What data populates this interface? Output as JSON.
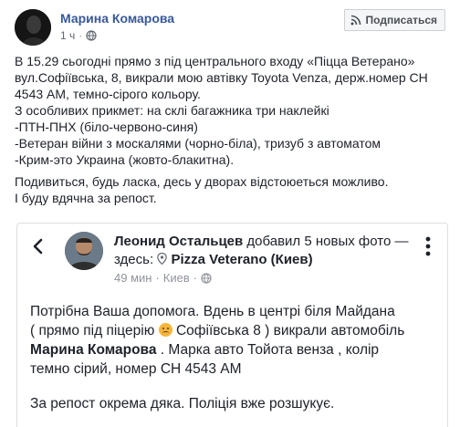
{
  "post": {
    "author": "Марина Комарова",
    "time": "1 ч",
    "privacy_icon": "globe-icon",
    "subscribe_label": "Подписаться",
    "subscribe_icon": "rss-icon",
    "lines": [
      "В 15.29 сьогодні прямо з під центрального входу «Піцца Ветерано»",
      "вул.Софіївська, 8, викрали мою автівку Toyota Venza, держ.номер СН",
      "4543 АМ, темно-сірого кольору.",
      "З особливих прикмет: на склі багажника три наклейкі",
      "-ПТН-ПНХ (біло-червоно-синя)",
      "-Ветеран війни з москалями (чорно-біла), тризуб з автоматом",
      "-Крим-это Украина (жовто-блакитна)."
    ],
    "lines2": [
      "Подивиться, будь ласка, десь у дворах відстоюеться можливо.",
      "І буду вдячна за репост."
    ]
  },
  "shared": {
    "author": "Леонид Остальцев",
    "action": " добавил 5 новых фото — здесь: ",
    "place": "Pizza Veterano (Киев)",
    "time": "49 мин",
    "location": "Киев",
    "body": {
      "line1": "Потрібна Ваша допомога. Вдень в центрі біля Майдана",
      "line2a": "( прямо під піцерію ",
      "line2b": " Софіївська 8 ) викрали автомобіль",
      "line3_name": "Марина Комарова",
      "line3_rest": " . Марка авто Тойота венза , колір",
      "line4": "темно сірий, номер СН 4543 АМ",
      "line5": "За репост окрема дяка. Поліція вже розшукує."
    }
  },
  "colors": {
    "link": "#385898",
    "text": "#1d2129",
    "meta": "#90949c"
  }
}
